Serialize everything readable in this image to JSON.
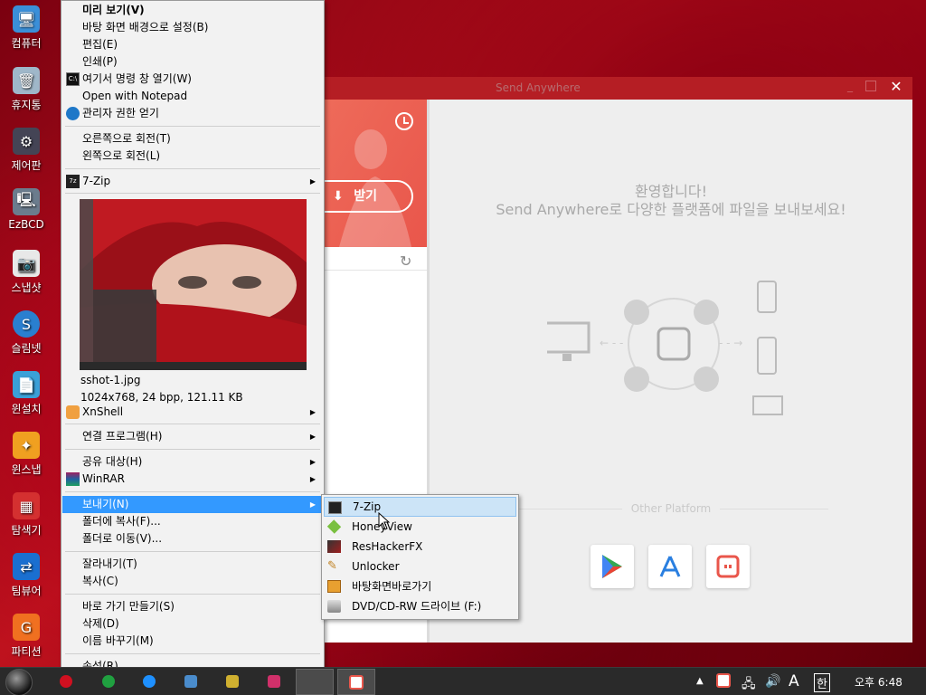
{
  "desktop_icons": [
    {
      "label": "컴퓨터",
      "icon": "computer-icon",
      "color": "#3a8fd8"
    },
    {
      "label": "휴지통",
      "icon": "recycle-bin-icon",
      "color": "#9fb7c9"
    },
    {
      "label": "제어판",
      "icon": "control-panel-icon",
      "color": "#556"
    },
    {
      "label": "EzBCD",
      "icon": "ezbcd-icon",
      "color": "#6b7c8d"
    },
    {
      "label": "스냅샷",
      "icon": "snapshot-icon",
      "color": "#e8e8e8"
    },
    {
      "label": "슬림넷",
      "icon": "slimnet-icon",
      "color": "#2a7fd0"
    },
    {
      "label": "윈설치",
      "icon": "wininstall-icon",
      "color": "#3aa0d8"
    },
    {
      "label": "윈스냅",
      "icon": "winsnap-icon",
      "color": "#f0a020"
    },
    {
      "label": "탐색기",
      "icon": "explorer-icon",
      "color": "#d43030"
    },
    {
      "label": "팀뷰어",
      "icon": "teamviewer-icon",
      "color": "#1a6fd0"
    },
    {
      "label": "파티션",
      "icon": "partition-icon",
      "color": "#f07020"
    }
  ],
  "send_anywhere": {
    "title": "Send Anywhere",
    "receive_label": "받기",
    "welcome_line1": "환영합니다!",
    "welcome_line2": "Send Anywhere로 다양한 플랫폼에 파일을 보내보세요!",
    "other_platform": "Other Platform",
    "close_glyph": "✕",
    "accent": "#e9564b"
  },
  "context_menu": {
    "items_top": [
      {
        "label": "미리 보기(V)",
        "bold": true
      },
      {
        "label": "바탕 화면 배경으로 설정(B)"
      },
      {
        "label": "편집(E)"
      },
      {
        "label": "인쇄(P)"
      },
      {
        "label": "여기서 명령 창 열기(W)",
        "icon": "cmd-icon"
      },
      {
        "label": "Open with Notepad"
      },
      {
        "label": "관리자 권한 얻기",
        "icon": "admin-icon"
      }
    ],
    "rotate_right": "오른쪽으로 회전(T)",
    "rotate_left": "왼쪽으로 회전(L)",
    "zip": "7-Zip",
    "preview_filename": "sshot-1.jpg",
    "preview_details": "1024x768, 24 bpp, 121.11 KB",
    "xnshell": "XnShell",
    "open_with": "연결 프로그램(H)",
    "share_with": "공유 대상(H)",
    "winrar": "WinRAR",
    "send_to": "보내기(N)",
    "copy_to_folder": "폴더에 복사(F)...",
    "move_to_folder": "폴더로 이동(V)...",
    "cut": "잘라내기(T)",
    "copy": "복사(C)",
    "create_shortcut": "바로 가기 만들기(S)",
    "delete": "삭제(D)",
    "rename": "이름 바꾸기(M)",
    "properties": "속성(R)"
  },
  "send_to_menu": [
    {
      "label": "7-Zip",
      "icon": "7zip-icon"
    },
    {
      "label": "HoneyView",
      "icon": "honeyview-icon"
    },
    {
      "label": "ResHackerFX",
      "icon": "reshacker-icon"
    },
    {
      "label": "Unlocker",
      "icon": "unlocker-icon"
    },
    {
      "label": "바탕화면바로가기",
      "icon": "desktop-shortcut-icon"
    },
    {
      "label": "DVD/CD-RW 드라이브 (F:)",
      "icon": "dvd-drive-icon"
    }
  ],
  "taskbar": {
    "clock": "오후 6:48",
    "ime_letter": "A",
    "ime_hangul": "한"
  }
}
